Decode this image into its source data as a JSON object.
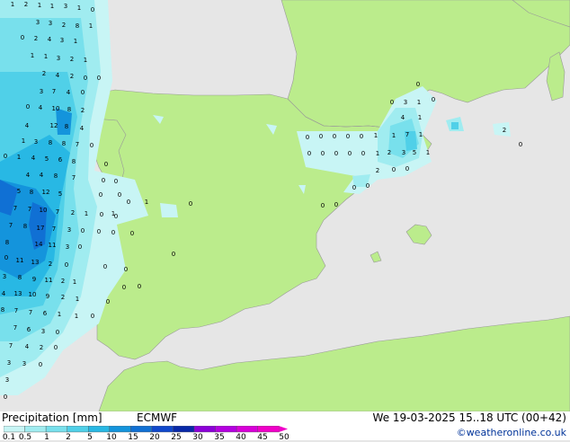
{
  "legend": {
    "title": "Precipitation [mm]",
    "model": "ECMWF",
    "valid": "We 19-03-2025 15..18 UTC (00+42)",
    "credit": "©weatheronline.co.uk",
    "scale_labels": [
      "0.1",
      "0.5",
      "1",
      "2",
      "5",
      "10",
      "15",
      "20",
      "25",
      "30",
      "35",
      "40",
      "45",
      "50"
    ],
    "scale_colors": [
      "#c8f5f5",
      "#a0ecf0",
      "#78e0ec",
      "#50d0e8",
      "#28b8e4",
      "#1494dc",
      "#1070d4",
      "#1048cc",
      "#0828a8",
      "#8c00d8",
      "#b400e0",
      "#d800d8",
      "#f000c8"
    ]
  },
  "colors": {
    "sea": "#e6e6e6",
    "land": "#bbec8c",
    "border": "#999999"
  },
  "points": [
    [
      "1",
      14,
      7
    ],
    [
      "2",
      29,
      7
    ],
    [
      "1",
      44,
      8
    ],
    [
      "1",
      58,
      9
    ],
    [
      "3",
      73,
      9
    ],
    [
      "1",
      88,
      11
    ],
    [
      "0",
      103,
      13
    ],
    [
      "3",
      42,
      27
    ],
    [
      "3",
      56,
      28
    ],
    [
      "2",
      71,
      30
    ],
    [
      "8",
      86,
      31
    ],
    [
      "1",
      101,
      31
    ],
    [
      "0",
      25,
      44
    ],
    [
      "2",
      40,
      45
    ],
    [
      "4",
      55,
      46
    ],
    [
      "3",
      69,
      47
    ],
    [
      "1",
      84,
      48
    ],
    [
      "1",
      36,
      64
    ],
    [
      "1",
      51,
      65
    ],
    [
      "3",
      65,
      67
    ],
    [
      "2",
      80,
      68
    ],
    [
      "1",
      95,
      69
    ],
    [
      "2",
      49,
      84
    ],
    [
      "4",
      64,
      86
    ],
    [
      "2",
      80,
      87
    ],
    [
      "0",
      95,
      89
    ],
    [
      "0",
      110,
      89
    ],
    [
      "3",
      46,
      104
    ],
    [
      "7",
      60,
      104
    ],
    [
      "4",
      76,
      105
    ],
    [
      "0",
      92,
      105
    ],
    [
      "0",
      31,
      121
    ],
    [
      "4",
      45,
      122
    ],
    [
      "10",
      62,
      123
    ],
    [
      "8",
      77,
      124
    ],
    [
      "2",
      92,
      125
    ],
    [
      "4",
      30,
      142
    ],
    [
      "12",
      60,
      142
    ],
    [
      "8",
      74,
      143
    ],
    [
      "4",
      91,
      145
    ],
    [
      "1",
      26,
      159
    ],
    [
      "3",
      40,
      160
    ],
    [
      "8",
      56,
      161
    ],
    [
      "8",
      71,
      162
    ],
    [
      "7",
      86,
      163
    ],
    [
      "0",
      102,
      164
    ],
    [
      "0",
      6,
      176
    ],
    [
      "1",
      21,
      177
    ],
    [
      "4",
      37,
      178
    ],
    [
      "5",
      52,
      179
    ],
    [
      "6",
      67,
      180
    ],
    [
      "8",
      82,
      182
    ],
    [
      "0",
      118,
      185
    ],
    [
      "4",
      31,
      197
    ],
    [
      "4",
      46,
      197
    ],
    [
      "8",
      62,
      198
    ],
    [
      "7",
      82,
      200
    ],
    [
      "0",
      115,
      203
    ],
    [
      "0",
      129,
      204
    ],
    [
      "5",
      21,
      215
    ],
    [
      "8",
      35,
      216
    ],
    [
      "12",
      51,
      216
    ],
    [
      "5",
      67,
      218
    ],
    [
      "0",
      112,
      219
    ],
    [
      "0",
      133,
      219
    ],
    [
      "7",
      17,
      234
    ],
    [
      "7",
      33,
      235
    ],
    [
      "10",
      48,
      236
    ],
    [
      "7",
      64,
      238
    ],
    [
      "2",
      81,
      239
    ],
    [
      "1",
      96,
      240
    ],
    [
      "0",
      113,
      241
    ],
    [
      "1",
      126,
      240
    ],
    [
      "0",
      143,
      227
    ],
    [
      "1",
      163,
      227
    ],
    [
      "7",
      12,
      253
    ],
    [
      "8",
      28,
      254
    ],
    [
      "17",
      45,
      256
    ],
    [
      "7",
      60,
      257
    ],
    [
      "3",
      77,
      258
    ],
    [
      "0",
      92,
      259
    ],
    [
      "0",
      110,
      260
    ],
    [
      "0",
      126,
      261
    ],
    [
      "0",
      147,
      262
    ],
    [
      "8",
      8,
      272
    ],
    [
      "14",
      43,
      274
    ],
    [
      "11",
      58,
      275
    ],
    [
      "3",
      75,
      277
    ],
    [
      "0",
      89,
      277
    ],
    [
      "0",
      7,
      289
    ],
    [
      "11",
      22,
      292
    ],
    [
      "13",
      39,
      294
    ],
    [
      "2",
      56,
      296
    ],
    [
      "0",
      74,
      297
    ],
    [
      "3",
      5,
      310
    ],
    [
      "8",
      22,
      311
    ],
    [
      "9",
      38,
      313
    ],
    [
      "11",
      54,
      314
    ],
    [
      "2",
      70,
      315
    ],
    [
      "1",
      83,
      316
    ],
    [
      "4",
      4,
      329
    ],
    [
      "13",
      20,
      329
    ],
    [
      "10",
      36,
      330
    ],
    [
      "9",
      53,
      332
    ],
    [
      "2",
      70,
      333
    ],
    [
      "1",
      86,
      335
    ],
    [
      "8",
      3,
      347
    ],
    [
      "7",
      18,
      348
    ],
    [
      "7",
      34,
      350
    ],
    [
      "6",
      50,
      351
    ],
    [
      "1",
      66,
      352
    ],
    [
      "1",
      85,
      354
    ],
    [
      "0",
      103,
      354
    ],
    [
      "7",
      17,
      367
    ],
    [
      "6",
      32,
      369
    ],
    [
      "3",
      48,
      371
    ],
    [
      "0",
      64,
      372
    ],
    [
      "7",
      12,
      387
    ],
    [
      "4",
      30,
      388
    ],
    [
      "2",
      46,
      389
    ],
    [
      "0",
      62,
      389
    ],
    [
      "3",
      10,
      406
    ],
    [
      "3",
      27,
      407
    ],
    [
      "0",
      45,
      408
    ],
    [
      "3",
      8,
      425
    ],
    [
      "0",
      6,
      444
    ],
    [
      "0",
      120,
      338
    ],
    [
      "0",
      138,
      322
    ],
    [
      "0",
      155,
      321
    ],
    [
      "0",
      140,
      302
    ],
    [
      "0",
      193,
      285
    ],
    [
      "0",
      212,
      229
    ],
    [
      "0",
      129,
      243
    ],
    [
      "0",
      359,
      231
    ],
    [
      "0",
      374,
      230
    ],
    [
      "0",
      394,
      211
    ],
    [
      "0",
      409,
      209
    ],
    [
      "2",
      420,
      192
    ],
    [
      "0",
      438,
      191
    ],
    [
      "0",
      453,
      190
    ],
    [
      "0",
      342,
      155
    ],
    [
      "0",
      357,
      154
    ],
    [
      "0",
      372,
      154
    ],
    [
      "0",
      387,
      154
    ],
    [
      "0",
      402,
      154
    ],
    [
      "1",
      418,
      153
    ],
    [
      "1",
      438,
      153
    ],
    [
      "7",
      453,
      152
    ],
    [
      "1",
      468,
      152
    ],
    [
      "0",
      344,
      173
    ],
    [
      "0",
      359,
      173
    ],
    [
      "0",
      374,
      173
    ],
    [
      "0",
      389,
      173
    ],
    [
      "0",
      404,
      173
    ],
    [
      "1",
      420,
      173
    ],
    [
      "2",
      433,
      172
    ],
    [
      "3",
      449,
      172
    ],
    [
      "5",
      461,
      172
    ],
    [
      "1",
      476,
      172
    ],
    [
      "0",
      465,
      96
    ],
    [
      "0",
      436,
      116
    ],
    [
      "3",
      451,
      116
    ],
    [
      "1",
      466,
      116
    ],
    [
      "0",
      482,
      113
    ],
    [
      "4",
      448,
      133
    ],
    [
      "1",
      467,
      133
    ],
    [
      "2",
      561,
      147
    ],
    [
      "0",
      579,
      163
    ],
    [
      "0",
      117,
      299
    ]
  ]
}
